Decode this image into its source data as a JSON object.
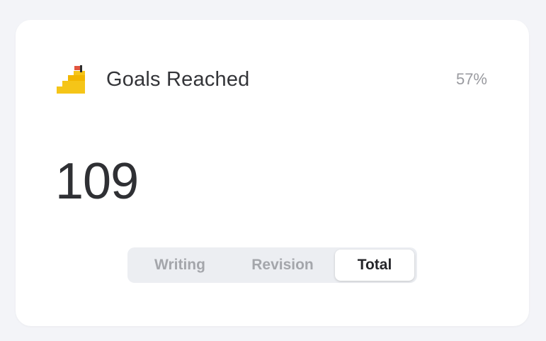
{
  "card": {
    "title": "Goals Reached",
    "percent": "57%",
    "value": "109",
    "icon": "stairs-flag-icon"
  },
  "tabs": [
    {
      "label": "Writing",
      "active": false
    },
    {
      "label": "Revision",
      "active": false
    },
    {
      "label": "Total",
      "active": true
    }
  ],
  "colors": {
    "background": "#f3f4f8",
    "card": "#ffffff",
    "stairs": "#f5c518",
    "flag": "#e2553f"
  }
}
